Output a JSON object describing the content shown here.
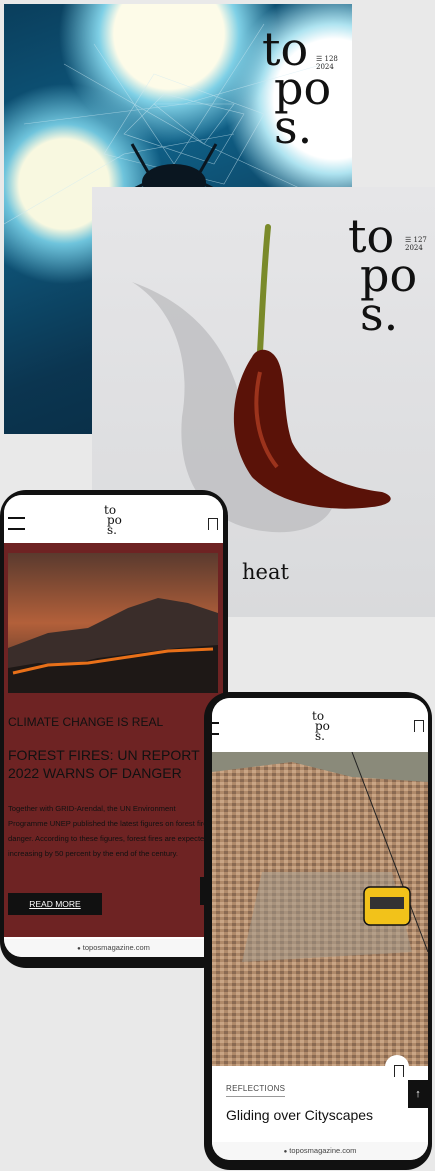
{
  "brand": {
    "logo_line1": "to",
    "logo_line2": "po",
    "logo_line3": "s."
  },
  "cover1": {
    "issue": "128",
    "year": "2024"
  },
  "cover2": {
    "issue": "127",
    "year": "2024",
    "title": "heat"
  },
  "phone1": {
    "tag": "CLIMATE CHANGE IS REAL",
    "headline": "FOREST FIRES: UN REPORT 2022 WARNS OF DANGER",
    "body": "Together with GRID-Arendal, the UN Environment Programme UNEP published the latest figures on forest fire danger. According to these figures, forest fires are expectedly increasing by 50 percent by the end of the century.",
    "read_more": "READ MORE",
    "url": "toposmagazine.com"
  },
  "phone2": {
    "category": "REFLECTIONS",
    "title": "Gliding over Cityscapes",
    "url": "toposmagazine.com"
  },
  "icons": {
    "up_arrow": "↑",
    "lock": "🔒"
  }
}
